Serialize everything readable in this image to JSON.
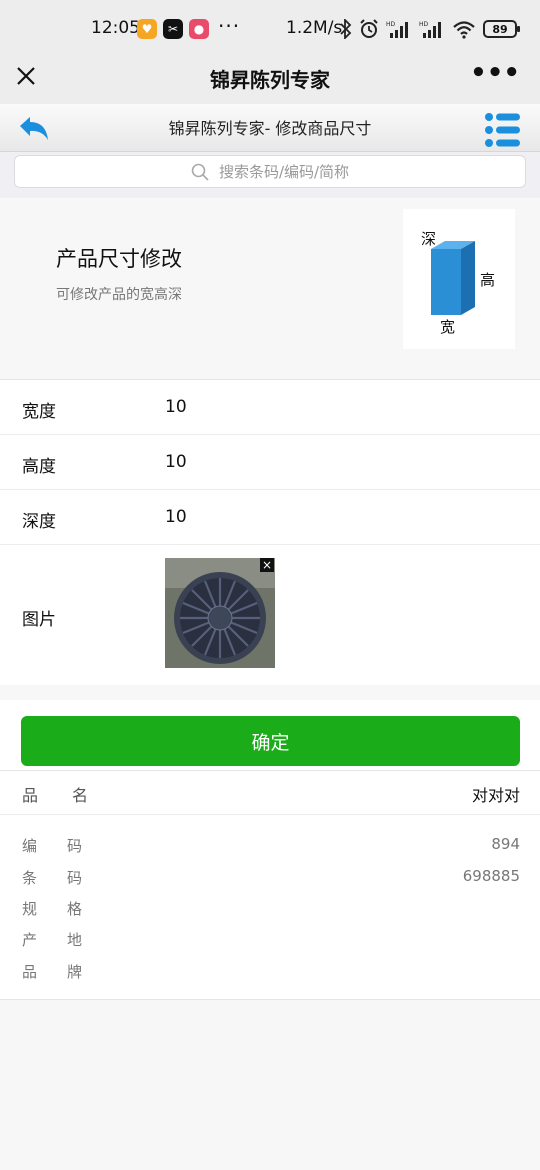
{
  "status_bar": {
    "time": "12:05",
    "speed": "1.2M/s",
    "battery": "89"
  },
  "title_bar": {
    "title": "锦昇陈列专家"
  },
  "page_header": {
    "title": "锦昇陈列专家- 修改商品尺寸"
  },
  "search": {
    "placeholder": "搜索条码/编码/简称"
  },
  "banner": {
    "title": "产品尺寸修改",
    "subtitle": "可修改产品的宽高深",
    "diagram_labels": {
      "depth": "深",
      "height": "高",
      "width": "宽"
    }
  },
  "form": {
    "width_label": "宽度",
    "width_value": "10",
    "height_label": "高度",
    "height_value": "10",
    "depth_label": "深度",
    "depth_value": "10",
    "image_label": "图片"
  },
  "confirm_label": "确定",
  "product_info": {
    "name_label": "品名",
    "name_value": "对对对",
    "rows": [
      {
        "label": "编码",
        "value": "894"
      },
      {
        "label": "条码",
        "value": "698885"
      },
      {
        "label": "规格",
        "value": ""
      },
      {
        "label": "产地",
        "value": ""
      },
      {
        "label": "品牌",
        "value": ""
      }
    ]
  },
  "colors": {
    "accent_green": "#1aad19",
    "header_blue": "#1a8fdd",
    "box_blue": "#2b8fd6"
  }
}
